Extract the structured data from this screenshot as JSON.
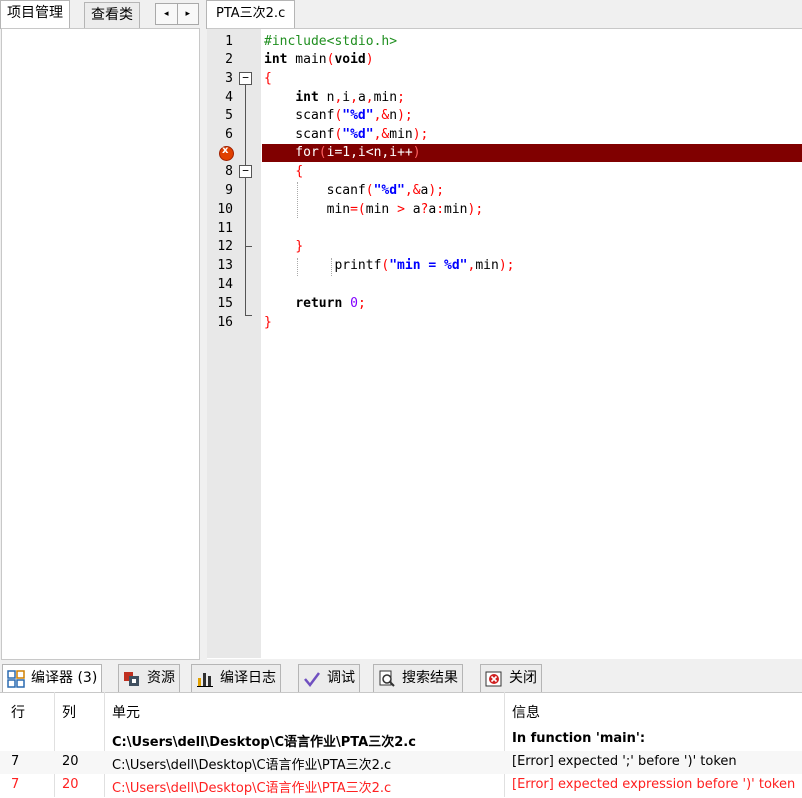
{
  "left_panel": {
    "tabs": [
      "项目管理",
      "查看类"
    ],
    "nav_prev": "◂",
    "nav_next": "▸"
  },
  "editor": {
    "file_tab": "PTA三次2.c",
    "line_numbers": [
      "1",
      "2",
      "3",
      "4",
      "5",
      "6",
      "7",
      "8",
      "9",
      "10",
      "11",
      "12",
      "13",
      "14",
      "15",
      "16"
    ],
    "error_line": 7
  },
  "bottom_tabs": [
    {
      "label": "编译器 (3)",
      "icon": "compiler-grid-icon"
    },
    {
      "label": "资源",
      "icon": "resources-icon"
    },
    {
      "label": "编译日志",
      "icon": "bar-chart-icon"
    },
    {
      "label": "调试",
      "icon": "check-icon"
    },
    {
      "label": "搜索结果",
      "icon": "magnifier-icon"
    },
    {
      "label": "关闭",
      "icon": "close-icon"
    }
  ],
  "results": {
    "headers": {
      "line": "行",
      "col": "列",
      "unit": "单元",
      "info": "信息"
    },
    "rows": [
      {
        "line": "",
        "col": "",
        "unit": "C:\\Users\\dell\\Desktop\\C语言作业\\PTA三次2.c",
        "info": "In function 'main':",
        "style": "bold"
      },
      {
        "line": "7",
        "col": "20",
        "unit": "C:\\Users\\dell\\Desktop\\C语言作业\\PTA三次2.c",
        "info": "[Error] expected ';' before ')' token",
        "style": "normal"
      },
      {
        "line": "7",
        "col": "20",
        "unit": "C:\\Users\\dell\\Desktop\\C语言作业\\PTA三次2.c",
        "info": "[Error] expected expression before ')' token",
        "style": "red"
      }
    ]
  },
  "colors": {
    "error_highlight": "#800000",
    "keyword": "#000000",
    "string": "#0000ff",
    "symbol": "#ff0000",
    "preprocessor": "#208f20",
    "number": "#8000ff",
    "error_text": "#ff2020"
  }
}
